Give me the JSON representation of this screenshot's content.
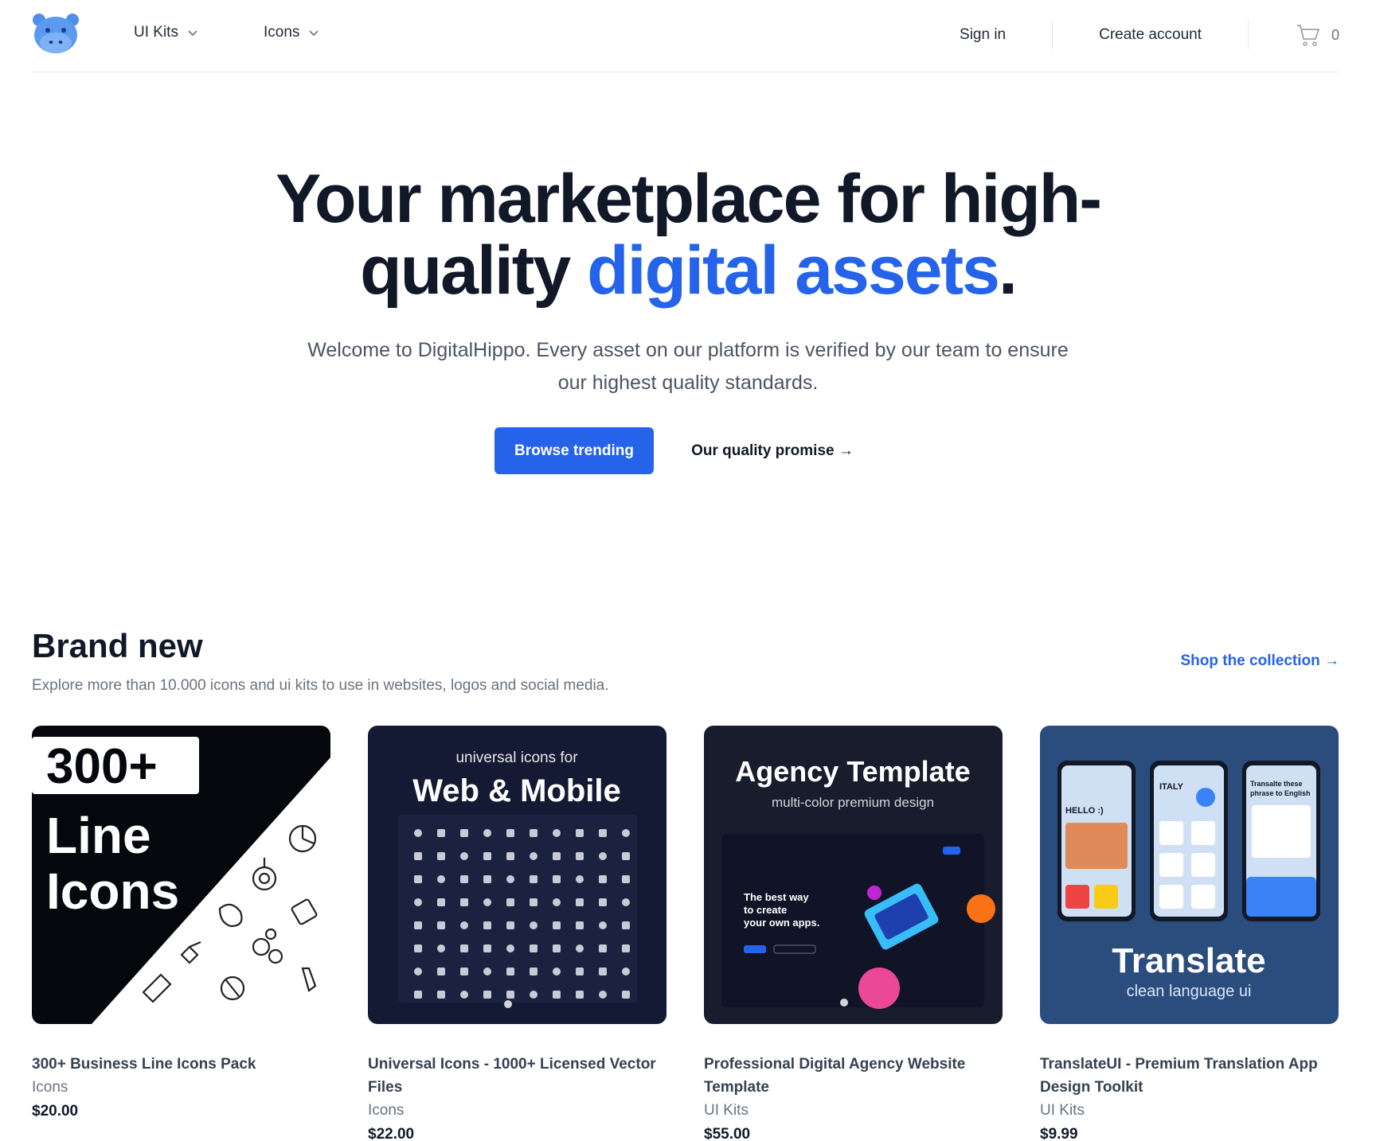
{
  "brand": {
    "name": "DigitalHippo"
  },
  "nav": {
    "menus": [
      {
        "label": "UI Kits"
      },
      {
        "label": "Icons"
      }
    ],
    "sign_in": "Sign in",
    "create_account": "Create account",
    "cart_count": "0"
  },
  "hero": {
    "title_line1": "Your marketplace for high-",
    "title_line2_plain": "quality ",
    "title_accent": "digital assets",
    "title_period": ".",
    "subtitle": "Welcome to DigitalHippo. Every asset on our platform is verified by our team to ensure our highest quality standards.",
    "primary_cta": "Browse trending",
    "secondary_cta": "Our quality promise →"
  },
  "section": {
    "title": "Brand new",
    "description": "Explore more than 10.000 icons and ui kits to use in websites, logos and social media.",
    "link": "Shop the collection →"
  },
  "products": [
    {
      "name": "300+ Business Line Icons Pack",
      "category": "Icons",
      "price": "$20.00",
      "thumb": {
        "badge": "300+",
        "line1": "Line",
        "line2": "Icons"
      }
    },
    {
      "name": "Universal Icons - 1000+ Licensed Vector Files",
      "category": "Icons",
      "price": "$22.00",
      "thumb": {
        "small": "universal icons for",
        "big": "Web & Mobile"
      }
    },
    {
      "name": "Professional Digital Agency Website Template",
      "category": "UI Kits",
      "price": "$55.00",
      "thumb": {
        "big": "Agency Template",
        "small": "multi-color premium design",
        "tagline1": "The best way",
        "tagline2": "to create",
        "tagline3": "your own apps."
      }
    },
    {
      "name": "TranslateUI - Premium Translation App Design Toolkit",
      "category": "UI Kits",
      "price": "$9.99",
      "thumb": {
        "big": "Translate",
        "small": "clean language ui",
        "phone1": "HELLO :)",
        "phone2": "ITALY",
        "phone3a": "Transalte these",
        "phone3b": "phrase to English"
      }
    }
  ],
  "colors": {
    "accent": "#2563eb",
    "text": "#111827",
    "muted": "#6b7280",
    "card_dark": "#141a33",
    "card_blue": "#2b4d7e"
  }
}
